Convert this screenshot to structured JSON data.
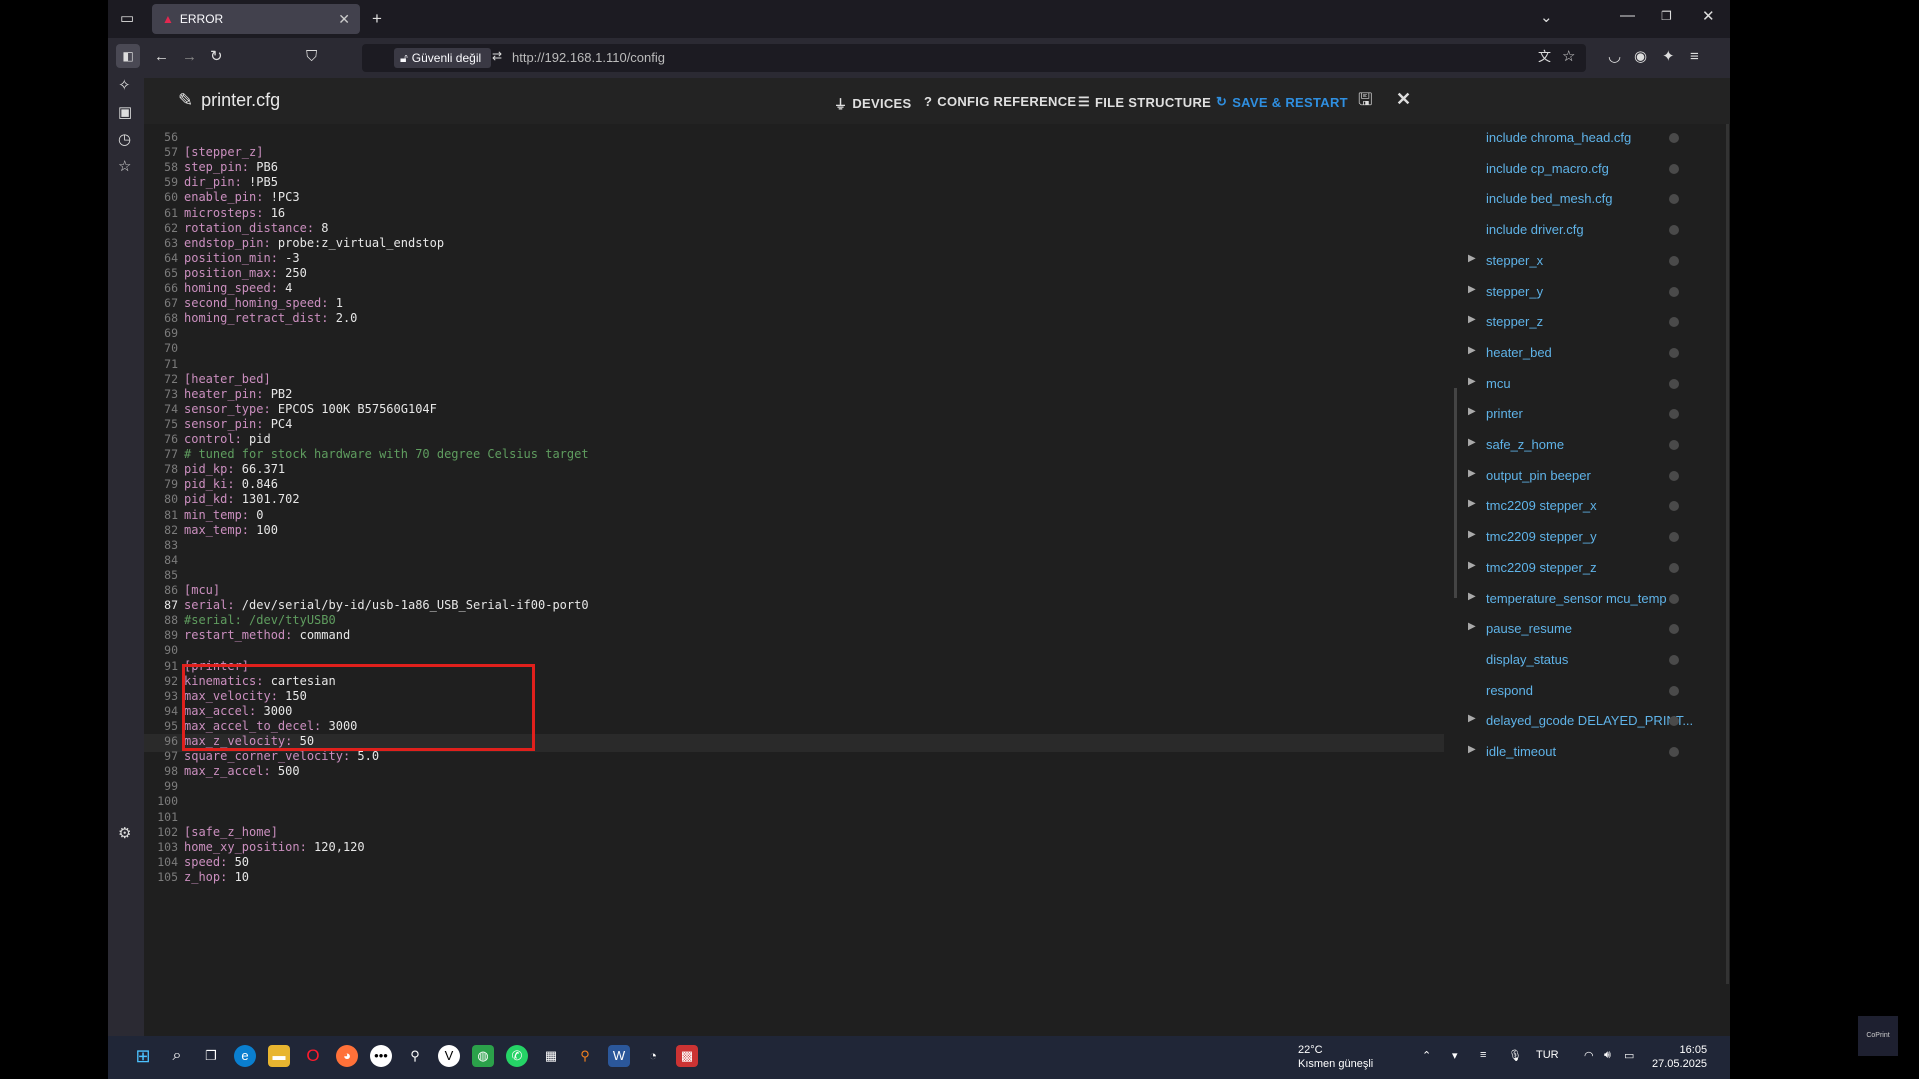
{
  "browser": {
    "tab_title": "ERROR",
    "security_label": "Güvenli değil",
    "url": "http://192.168.1.110/config"
  },
  "app": {
    "file_title": "printer.cfg",
    "devices_label": "DEVICES",
    "config_reference_label": "CONFIG REFERENCE",
    "file_structure_label": "FILE STRUCTURE",
    "save_restart_label": "SAVE & RESTART"
  },
  "editor": {
    "lines": [
      {
        "n": "56",
        "key": "",
        "val": "",
        "cls": ""
      },
      {
        "n": "57",
        "key": "[stepper_z]",
        "val": "",
        "cls": "k"
      },
      {
        "n": "58",
        "key": "step_pin: ",
        "val": "PB6",
        "cls": "k"
      },
      {
        "n": "59",
        "key": "dir_pin: ",
        "val": "!PB5",
        "cls": "k"
      },
      {
        "n": "60",
        "key": "enable_pin: ",
        "val": "!PC3",
        "cls": "k"
      },
      {
        "n": "61",
        "key": "microsteps: ",
        "val": "16",
        "cls": "k"
      },
      {
        "n": "62",
        "key": "rotation_distance: ",
        "val": "8",
        "cls": "k"
      },
      {
        "n": "63",
        "key": "endstop_pin: ",
        "val": "probe:z_virtual_endstop",
        "cls": "k"
      },
      {
        "n": "64",
        "key": "position_min: ",
        "val": "-3",
        "cls": "k"
      },
      {
        "n": "65",
        "key": "position_max: ",
        "val": "250",
        "cls": "k"
      },
      {
        "n": "66",
        "key": "homing_speed: ",
        "val": "4",
        "cls": "k"
      },
      {
        "n": "67",
        "key": "second_homing_speed: ",
        "val": "1",
        "cls": "k"
      },
      {
        "n": "68",
        "key": "homing_retract_dist: ",
        "val": "2.0",
        "cls": "k"
      },
      {
        "n": "69",
        "key": "",
        "val": "",
        "cls": ""
      },
      {
        "n": "70",
        "key": "",
        "val": "",
        "cls": ""
      },
      {
        "n": "71",
        "key": "",
        "val": "",
        "cls": ""
      },
      {
        "n": "72",
        "key": "[heater_bed]",
        "val": "",
        "cls": "k"
      },
      {
        "n": "73",
        "key": "heater_pin: ",
        "val": "PB2",
        "cls": "k"
      },
      {
        "n": "74",
        "key": "sensor_type: ",
        "val": "EPCOS 100K B57560G104F",
        "cls": "k"
      },
      {
        "n": "75",
        "key": "sensor_pin: ",
        "val": "PC4",
        "cls": "k"
      },
      {
        "n": "76",
        "key": "control: ",
        "val": "pid",
        "cls": "k"
      },
      {
        "n": "77",
        "key": "# tuned for stock hardware with 70 degree Celsius target",
        "val": "",
        "cls": "c"
      },
      {
        "n": "78",
        "key": "pid_kp: ",
        "val": "66.371",
        "cls": "k"
      },
      {
        "n": "79",
        "key": "pid_ki: ",
        "val": "0.846",
        "cls": "k"
      },
      {
        "n": "80",
        "key": "pid_kd: ",
        "val": "1301.702",
        "cls": "k"
      },
      {
        "n": "81",
        "key": "min_temp: ",
        "val": "0",
        "cls": "k"
      },
      {
        "n": "82",
        "key": "max_temp: ",
        "val": "100",
        "cls": "k"
      },
      {
        "n": "83",
        "key": "",
        "val": "",
        "cls": ""
      },
      {
        "n": "84",
        "key": "",
        "val": "",
        "cls": ""
      },
      {
        "n": "85",
        "key": "",
        "val": "",
        "cls": ""
      },
      {
        "n": "86",
        "key": "[mcu]",
        "val": "",
        "cls": "k"
      },
      {
        "n": "87",
        "key": "serial: ",
        "val": "/dev/serial/by-id/usb-1a86_USB_Serial-if00-port0",
        "cls": "k"
      },
      {
        "n": "88",
        "key": "#serial: /dev/ttyUSB0",
        "val": "",
        "cls": "c"
      },
      {
        "n": "89",
        "key": "restart_method: ",
        "val": "command",
        "cls": "k"
      },
      {
        "n": "90",
        "key": "",
        "val": "",
        "cls": ""
      },
      {
        "n": "91",
        "key": "[printer]",
        "val": "",
        "cls": "k"
      },
      {
        "n": "92",
        "key": "kinematics: ",
        "val": "cartesian",
        "cls": "k"
      },
      {
        "n": "93",
        "key": "max_velocity: ",
        "val": "150",
        "cls": "k"
      },
      {
        "n": "94",
        "key": "max_accel: ",
        "val": "3000",
        "cls": "k"
      },
      {
        "n": "95",
        "key": "max_accel_to_decel: ",
        "val": "3000",
        "cls": "k"
      },
      {
        "n": "96",
        "key": "max_z_velocity: ",
        "val": "50",
        "cls": "k"
      },
      {
        "n": "97",
        "key": "square_corner_velocity: ",
        "val": "5.0",
        "cls": "k"
      },
      {
        "n": "98",
        "key": "max_z_accel: ",
        "val": "500",
        "cls": "k"
      },
      {
        "n": "99",
        "key": "",
        "val": "",
        "cls": ""
      },
      {
        "n": "100",
        "key": "",
        "val": "",
        "cls": ""
      },
      {
        "n": "101",
        "key": "",
        "val": "",
        "cls": ""
      },
      {
        "n": "102",
        "key": "[safe_z_home]",
        "val": "",
        "cls": "k"
      },
      {
        "n": "103",
        "key": "home_xy_position: ",
        "val": "120,120",
        "cls": "k"
      },
      {
        "n": "104",
        "key": "speed: ",
        "val": "50",
        "cls": "k"
      },
      {
        "n": "105",
        "key": "z_hop: ",
        "val": "10",
        "cls": "k"
      }
    ],
    "current_line": "87"
  },
  "outline": {
    "items": [
      {
        "label": "include chroma_head.cfg",
        "arrow": false
      },
      {
        "label": "include cp_macro.cfg",
        "arrow": false
      },
      {
        "label": "include bed_mesh.cfg",
        "arrow": false
      },
      {
        "label": "include driver.cfg",
        "arrow": false
      },
      {
        "label": "stepper_x",
        "arrow": true
      },
      {
        "label": "stepper_y",
        "arrow": true
      },
      {
        "label": "stepper_z",
        "arrow": true
      },
      {
        "label": "heater_bed",
        "arrow": true
      },
      {
        "label": "mcu",
        "arrow": true
      },
      {
        "label": "printer",
        "arrow": true
      },
      {
        "label": "safe_z_home",
        "arrow": true
      },
      {
        "label": "output_pin beeper",
        "arrow": true
      },
      {
        "label": "tmc2209 stepper_x",
        "arrow": true
      },
      {
        "label": "tmc2209 stepper_y",
        "arrow": true
      },
      {
        "label": "tmc2209 stepper_z",
        "arrow": true
      },
      {
        "label": "temperature_sensor mcu_temp",
        "arrow": true
      },
      {
        "label": "pause_resume",
        "arrow": true
      },
      {
        "label": "display_status",
        "arrow": false
      },
      {
        "label": "respond",
        "arrow": false
      },
      {
        "label": "delayed_gcode DELAYED_PRINT...",
        "arrow": true
      },
      {
        "label": "idle_timeout",
        "arrow": true
      }
    ]
  },
  "taskbar": {
    "weather_temp": "22°C",
    "weather_desc": "Kısmen güneşli",
    "language": "TUR",
    "time": "16:05",
    "date": "27.05.2025"
  },
  "colors": {
    "accent": "#2f8fe0",
    "highlight_box": "#e0201c",
    "keyword": "#cb8fbf"
  }
}
